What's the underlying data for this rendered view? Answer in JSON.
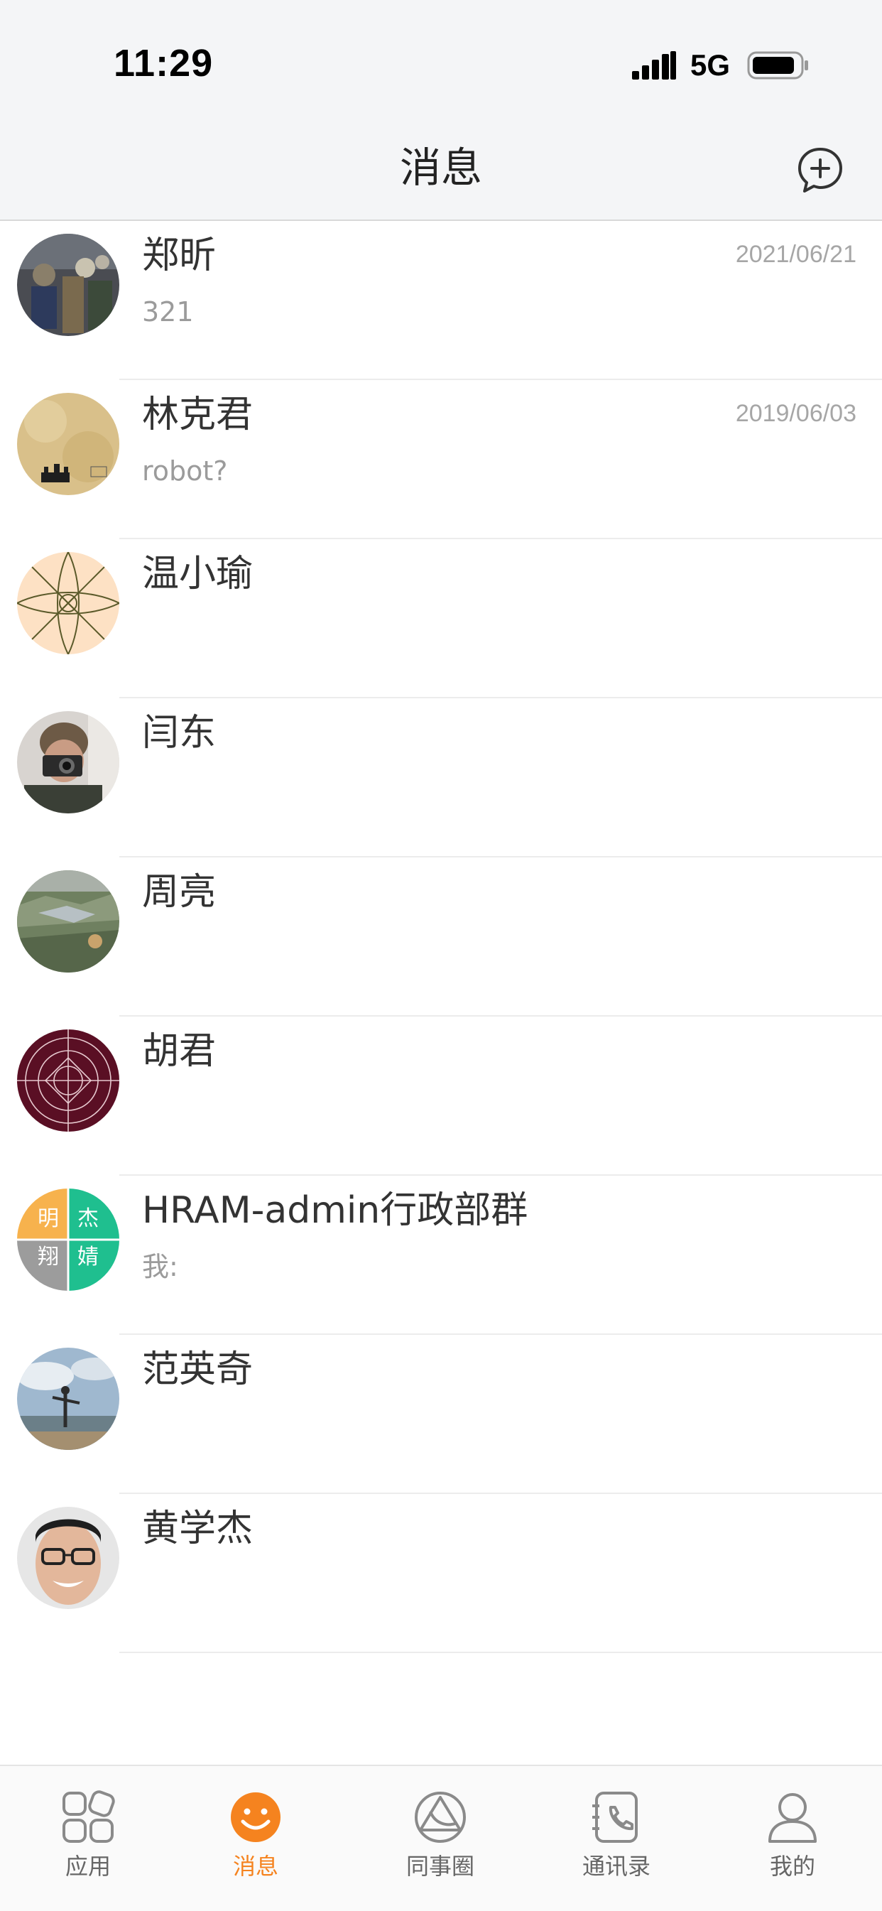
{
  "status_bar": {
    "time": "11:29",
    "network": "5G"
  },
  "header": {
    "title": "消息"
  },
  "conversations": [
    {
      "name": "郑昕",
      "preview": "321",
      "date": "2021/06/21",
      "avatar": "photo-group"
    },
    {
      "name": "林克君",
      "preview": "robot?",
      "date": "2019/06/03",
      "avatar": "parchment-castle"
    },
    {
      "name": "温小瑜",
      "preview": "",
      "date": "",
      "avatar": "peach-pattern"
    },
    {
      "name": "闫东",
      "preview": "",
      "date": "",
      "avatar": "photo-camera-man"
    },
    {
      "name": "周亮",
      "preview": "",
      "date": "",
      "avatar": "photo-landscape"
    },
    {
      "name": "胡君",
      "preview": "",
      "date": "",
      "avatar": "maroon-pattern"
    },
    {
      "name": "HRAM-admin行政部群",
      "preview": "我:",
      "date": "",
      "avatar": "group-quad",
      "group_chars": [
        "明",
        "杰",
        "翔",
        "婧"
      ]
    },
    {
      "name": "范英奇",
      "preview": "",
      "date": "",
      "avatar": "photo-beach"
    },
    {
      "name": "黄学杰",
      "preview": "",
      "date": "",
      "avatar": "photo-face"
    }
  ],
  "tabs": [
    {
      "label": "应用",
      "icon": "apps-grid-icon",
      "active": false
    },
    {
      "label": "消息",
      "icon": "smiley-message-icon",
      "active": true
    },
    {
      "label": "同事圈",
      "icon": "colleague-circle-icon",
      "active": false
    },
    {
      "label": "通讯录",
      "icon": "contacts-phone-icon",
      "active": false
    },
    {
      "label": "我的",
      "icon": "profile-person-icon",
      "active": false
    }
  ],
  "colors": {
    "accent": "#f5831f",
    "header_bg": "#f4f5f7",
    "group_orange": "#f7b24d",
    "group_green": "#1fbf8f",
    "group_gray": "#9c9c9c"
  }
}
